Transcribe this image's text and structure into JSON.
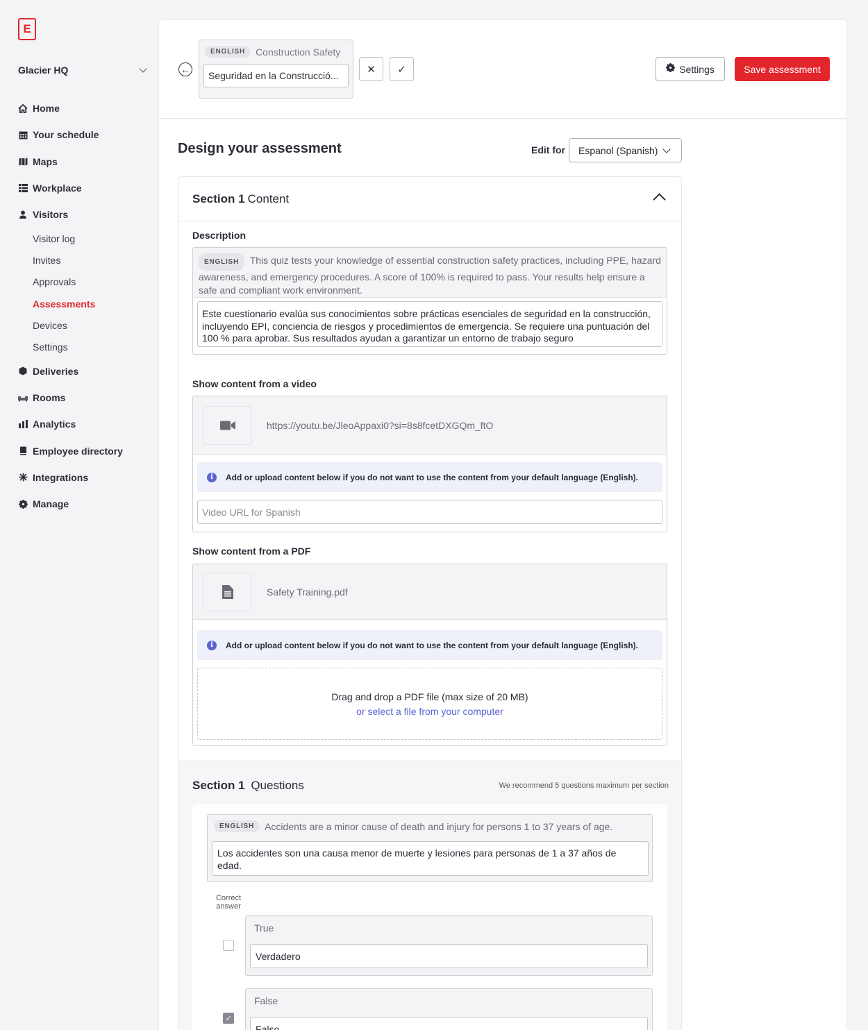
{
  "sidebar": {
    "logo_letter": "E",
    "org_name": "Glacier HQ",
    "items": [
      {
        "label": "Home",
        "icon": "home-icon"
      },
      {
        "label": "Your schedule",
        "icon": "calendar-icon"
      },
      {
        "label": "Maps",
        "icon": "map-icon"
      },
      {
        "label": "Workplace",
        "icon": "list-icon"
      },
      {
        "label": "Visitors",
        "icon": "person-icon"
      }
    ],
    "visitor_subitems": [
      "Visitor log",
      "Invites",
      "Approvals",
      "Assessments",
      "Devices",
      "Settings"
    ],
    "active_subitem": "Assessments",
    "items_after": [
      {
        "label": "Deliveries",
        "icon": "box-icon"
      },
      {
        "label": "Rooms",
        "icon": "couch-icon"
      },
      {
        "label": "Analytics",
        "icon": "bar-chart-icon"
      },
      {
        "label": "Employee directory",
        "icon": "book-icon"
      },
      {
        "label": "Integrations",
        "icon": "puzzle-icon"
      },
      {
        "label": "Manage",
        "icon": "gear-icon"
      }
    ],
    "accent_color": "#e3262c"
  },
  "topbar": {
    "lang_pill": "ENGLISH",
    "english_title": "Construction Safety",
    "translated_title": "Seguridad en la Construcció...",
    "settings_label": "Settings",
    "save_label": "Save assessment"
  },
  "design": {
    "title": "Design your assessment",
    "edit_for_label": "Edit for",
    "edit_for_value": "Espanol (Spanish)"
  },
  "section": {
    "number_label": "Section 1",
    "content_label": "Content",
    "description_label": "Description",
    "lang_pill": "ENGLISH",
    "description_en": "This quiz tests your knowledge of essential construction safety practices, including PPE, hazard awareness, and emergency procedures. A score of 100% is required to pass. Your results help ensure a safe and compliant work environment.",
    "description_es": "Este cuestionario evalúa sus conocimientos sobre prácticas esenciales de seguridad en la construcción, incluyendo EPI, conciencia de riesgos y procedimientos de emergencia. Se requiere una puntuación del 100 % para aprobar. Sus resultados ayudan a garantizar un entorno de trabajo seguro",
    "video_label": "Show content from a video",
    "video_url": "https://youtu.be/JleoAppaxi0?si=8s8fcetDXGQm_ftO",
    "info_text": "Add or upload content below if you do not want to use the content from your default language (English).",
    "video_placeholder": "Video URL for Spanish",
    "pdf_label": "Show content from a PDF",
    "pdf_file": "Safety Training.pdf",
    "dropzone_text": "Drag and drop a PDF file (max size of 20 MB)",
    "dropzone_link": "or select a file from your computer"
  },
  "questions": {
    "number_label": "Section 1",
    "title": "Questions",
    "recommendation": "We recommend 5 questions maximum per section",
    "lang_pill": "ENGLISH",
    "question_en": "Accidents are a minor cause of death and injury for persons 1 to 37 years of age.",
    "question_es": "Los accidentes son una causa menor de muerte y lesiones para personas de 1 a 37 años de edad.",
    "correct_answer_label": "Correct answer",
    "answers": [
      {
        "en": "True",
        "es": "Verdadero",
        "correct": false
      },
      {
        "en": "False",
        "es": "Falso",
        "correct": true
      }
    ]
  }
}
